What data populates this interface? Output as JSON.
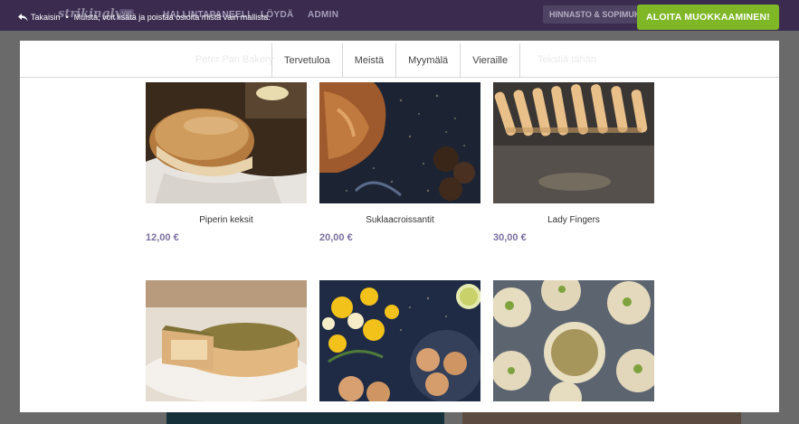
{
  "background": {
    "logo": "strikingly",
    "logo_badge": "VIP",
    "nav": [
      "HALLINTAPANEELI",
      "LÖYDÄ",
      "ADMIN"
    ],
    "pricing_button": "HINNASTO & SOPIMUKSET",
    "colors": {
      "topbar": "#3b2c4f",
      "overlay": "#6a6a6a"
    }
  },
  "notice": {
    "back_label": "Takaisin",
    "separator": "•",
    "message": "Muista, voit lisätä ja poistaa osioita mistä vain mallista.",
    "back_icon": "reply-arrow-icon"
  },
  "cta": {
    "label": "ALOITA MUOKKAAMINEN!",
    "color": "#7fb726"
  },
  "site": {
    "nav_tabs": [
      "Tervetuloa",
      "Meistä",
      "Myymälä",
      "Vieraille"
    ],
    "ghost_nav": [
      "Peter Pan Bakery",
      "Tekstiä tähän"
    ],
    "price_color": "#7b6f9f",
    "products": [
      {
        "name": "Piperin keksit",
        "price": "12,00 €",
        "image": "bread-loaf-photo"
      },
      {
        "name": "Suklaacroissantit",
        "price": "20,00 €",
        "image": "croissant-truffles-photo"
      },
      {
        "name": "Lady Fingers",
        "price": "30,00 €",
        "image": "lady-fingers-photo"
      },
      {
        "name": "",
        "price": "",
        "image": "quiche-photo"
      },
      {
        "name": "",
        "price": "",
        "image": "flowers-cookies-photo"
      },
      {
        "name": "",
        "price": "",
        "image": "pistachio-cookies-photo"
      }
    ]
  }
}
